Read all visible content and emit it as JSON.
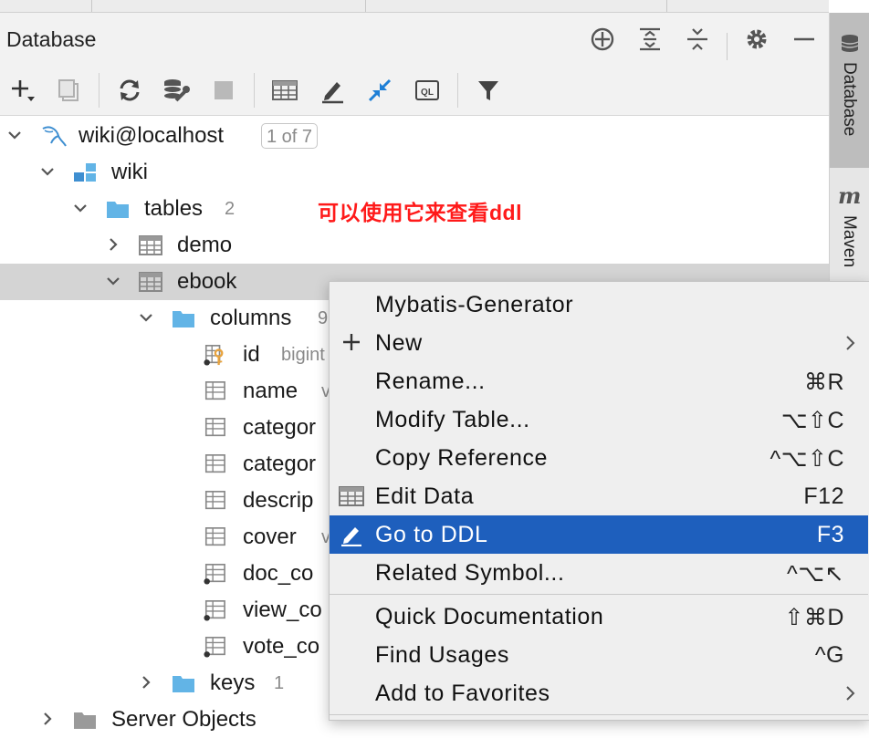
{
  "window": {
    "title": "Database"
  },
  "tree": {
    "root": {
      "label": "wiki@localhost",
      "badge": "1 of 7"
    },
    "schema": {
      "label": "wiki"
    },
    "tables_folder": {
      "label": "tables",
      "count": "2"
    },
    "tables": [
      {
        "label": "demo"
      },
      {
        "label": "ebook"
      }
    ],
    "columns_folder": {
      "label": "columns",
      "count": "9"
    },
    "columns": [
      {
        "label": "id",
        "type": "bigint"
      },
      {
        "label": "name",
        "type": "v"
      },
      {
        "label": "categor",
        "type": ""
      },
      {
        "label": "categor",
        "type": ""
      },
      {
        "label": "descrip",
        "type": ""
      },
      {
        "label": "cover",
        "type": "v"
      },
      {
        "label": "doc_co",
        "type": ""
      },
      {
        "label": "view_co",
        "type": ""
      },
      {
        "label": "vote_co",
        "type": ""
      }
    ],
    "keys_folder": {
      "label": "keys",
      "count": "1"
    },
    "server_objects": {
      "label": "Server Objects"
    }
  },
  "annotation": "可以使用它来查看ddl",
  "context_menu": {
    "items": [
      {
        "label": "Mybatis-Generator",
        "shortcut": ""
      },
      {
        "label": "New",
        "shortcut": ""
      },
      {
        "label": "Rename...",
        "shortcut": "⌘R"
      },
      {
        "label": "Modify Table...",
        "shortcut": "⌥⇧C"
      },
      {
        "label": "Copy Reference",
        "shortcut": "^⌥⇧C"
      },
      {
        "label": "Edit Data",
        "shortcut": "F12"
      },
      {
        "label": "Go to DDL",
        "shortcut": "F3"
      },
      {
        "label": "Related Symbol...",
        "shortcut": "^⌥↖"
      },
      {
        "label": "Quick Documentation",
        "shortcut": "⇧⌘D"
      },
      {
        "label": "Find Usages",
        "shortcut": "^G"
      },
      {
        "label": "Add to Favorites",
        "shortcut": ""
      }
    ]
  },
  "sidebar": {
    "tabs": [
      {
        "label": "Database"
      },
      {
        "label": "Maven"
      }
    ]
  },
  "colors": {
    "highlight": "#1e5fbd",
    "folder": "#62b4e6",
    "annotation": "#ff1a1a",
    "key": "#e8a33d"
  }
}
